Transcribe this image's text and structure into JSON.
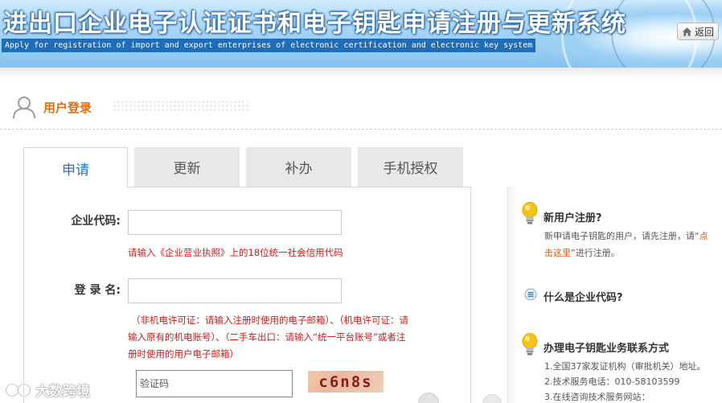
{
  "banner": {
    "title": "进出口企业电子认证证书和电子钥匙申请注册与更新系统",
    "subtitle": "Apply for registration of import and export enterprises of electronic certification and electronic key system",
    "back_label": "返回"
  },
  "login": {
    "label": "用户登录"
  },
  "tabs": [
    {
      "label": "申请",
      "active": true
    },
    {
      "label": "更新",
      "active": false
    },
    {
      "label": "补办",
      "active": false
    },
    {
      "label": "手机授权",
      "active": false
    }
  ],
  "form": {
    "company_code_label": "企业代码:",
    "company_code_value": "",
    "company_code_hint": "请输入《企业营业执照》上的18位统一社会信用代码",
    "login_name_label": "登 录 名:",
    "login_name_value": "",
    "login_name_hint_1": "（非机电许可证：请输入注册时使用的电子邮箱）、（机电许可证：请",
    "login_name_hint_2": "输入原有的机电账号）、（二手车出口：请输入“统一平台账号”或者注",
    "login_name_hint_3": "册时使用的用户电子邮箱）",
    "captcha_placeholder": "验证码",
    "captcha_text": "c6n8s"
  },
  "side": {
    "new_user_title": "新用户注册?",
    "new_user_text_1": "新申请电子钥匙的用户，请先注册，请“",
    "new_user_link_1": "点",
    "new_user_link_2": "击这里",
    "new_user_text_2": "”进行注册。",
    "company_code_title": "什么是企业代码?",
    "contact_title": "办理电子钥匙业务联系方式",
    "contact_items": [
      "1.全国37家发证机构（审批机关）地址。",
      "2.技术服务电话：010-58103599",
      "3.在线咨询技术服务网站："
    ]
  },
  "watermark": {
    "text": "大数跨境"
  },
  "colors": {
    "accent_orange": "#e46b0c",
    "tab_active_blue": "#2b73c8",
    "hint_red": "#cc1b1b",
    "banner_blue": "#1f6cb9"
  },
  "icons": {
    "back": "home-icon",
    "login": "user-icon",
    "side_tips": "lightbulb-icon",
    "side_info": "info-icon"
  }
}
